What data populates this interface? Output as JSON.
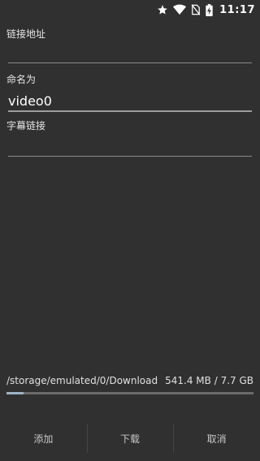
{
  "status_bar": {
    "time": "11:17",
    "icons": [
      "star-icon",
      "wifi-icon",
      "no-sim-icon",
      "battery-charging-icon"
    ]
  },
  "form": {
    "link": {
      "label": "链接地址",
      "value": "",
      "placeholder": ""
    },
    "name": {
      "label": "命名为",
      "value": "video0"
    },
    "subtitle": {
      "label": "字幕链接",
      "value": "",
      "placeholder": ""
    }
  },
  "storage": {
    "path": "/storage/emulated/0/Download",
    "size": "541.4 MB / 7.7 GB",
    "used_fraction": 0.07
  },
  "buttons": {
    "add": "添加",
    "download": "下载",
    "cancel": "取消"
  },
  "colors": {
    "background": "#303030",
    "progress": "#9fb4c4"
  }
}
